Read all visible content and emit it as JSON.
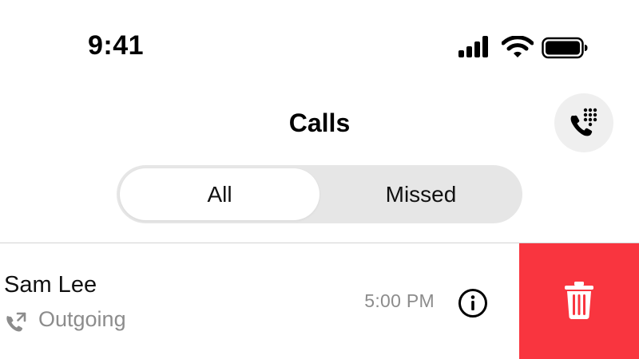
{
  "status_bar": {
    "time": "9:41"
  },
  "header": {
    "title": "Calls",
    "dialpad_icon": "phone-keypad-icon"
  },
  "filter": {
    "segments": [
      "All",
      "Missed"
    ],
    "selected": "All"
  },
  "calls": [
    {
      "name": "Sam Lee",
      "type": "Outgoing",
      "type_icon": "outgoing-call-icon",
      "time": "5:00 PM",
      "info_icon": "info-icon"
    }
  ],
  "swipe_action": {
    "icon": "trash-icon",
    "color": "#F9353F"
  },
  "colors": {
    "secondary_text": "#8C8C8C",
    "segment_bg": "#E6E6E6",
    "button_bg": "#EFEFEF",
    "delete_red": "#F9353F"
  }
}
